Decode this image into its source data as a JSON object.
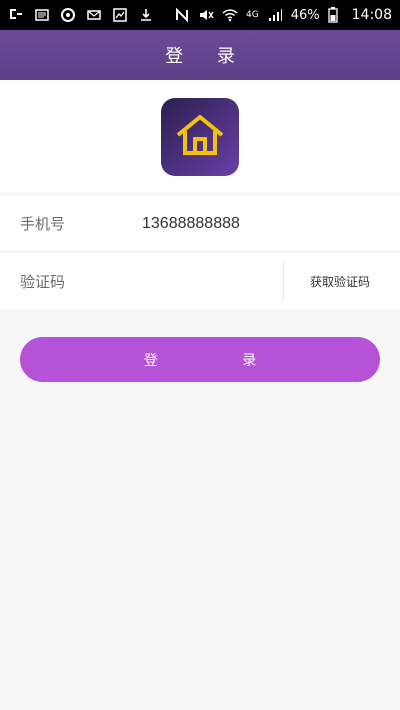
{
  "status_bar": {
    "signal_text": "4G",
    "battery_percent": "46%",
    "time": "14:08"
  },
  "header": {
    "title": "登 录"
  },
  "logo": {
    "icon_name": "home-icon",
    "colors": {
      "tile_gradient_start": "#2b1f4f",
      "tile_gradient_end": "#6a3fa7",
      "house_stroke": "#f3c20b"
    }
  },
  "form": {
    "phone": {
      "label": "手机号",
      "value": "13688888888"
    },
    "code": {
      "label": "验证码",
      "value": "",
      "get_code_label": "获取验证码"
    },
    "login_label": "登 录"
  },
  "colors": {
    "appbar": "#6d4a98",
    "button": "#b552d8",
    "background": "#f7f7f7"
  }
}
